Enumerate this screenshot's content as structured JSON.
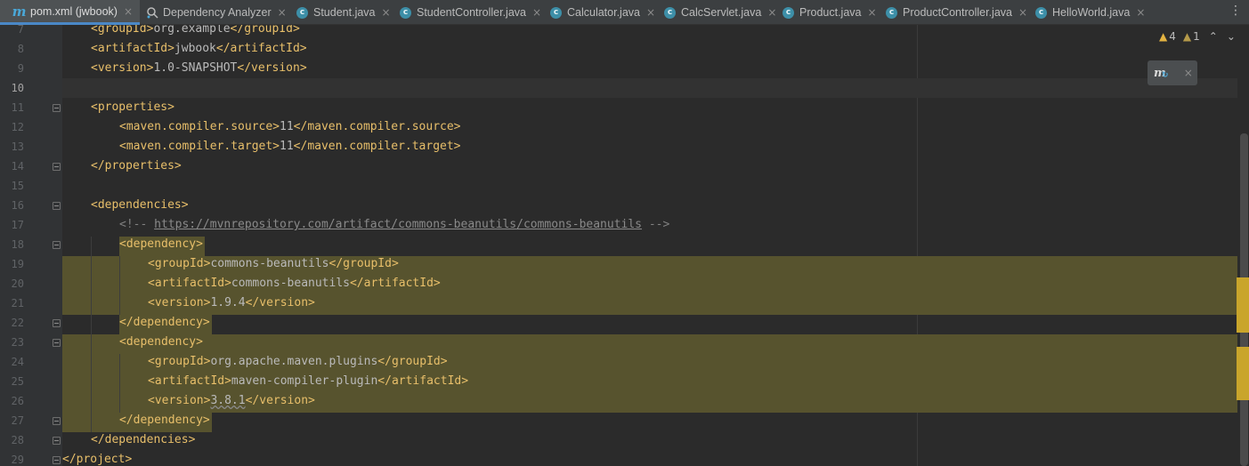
{
  "tabs": [
    {
      "label": "pom.xml (jwbook)",
      "icon": "maven-file-icon",
      "active": true
    },
    {
      "label": "Dependency Analyzer",
      "icon": "dependency-analyzer-icon"
    },
    {
      "label": "Student.java",
      "icon": "java-class-icon"
    },
    {
      "label": "StudentController.java",
      "icon": "java-class-icon"
    },
    {
      "label": "Calculator.java",
      "icon": "java-class-icon"
    },
    {
      "label": "CalcServlet.java",
      "icon": "java-class-icon"
    },
    {
      "label": "Product.java",
      "icon": "java-class-icon"
    },
    {
      "label": "ProductController.java",
      "icon": "java-class-icon"
    },
    {
      "label": "HelloWorld.java",
      "icon": "java-class-icon"
    }
  ],
  "icon_glyphs": {
    "maven": "m",
    "java_class": "c",
    "close": "×",
    "menu": "⋮"
  },
  "inspection": {
    "warnings": "4",
    "weak_warnings": "1"
  },
  "lines": [
    {
      "n": "7",
      "code": "<groupId>org.example</groupId>"
    },
    {
      "n": "8",
      "code": "<artifactId>jwbook</artifactId>"
    },
    {
      "n": "9",
      "code": "<version>1.0-SNAPSHOT</version>"
    },
    {
      "n": "10",
      "code": ""
    },
    {
      "n": "11",
      "code": "<properties>"
    },
    {
      "n": "12",
      "code": "<maven.compiler.source>11</maven.compiler.source>"
    },
    {
      "n": "13",
      "code": "<maven.compiler.target>11</maven.compiler.target>"
    },
    {
      "n": "14",
      "code": "</properties>"
    },
    {
      "n": "15",
      "code": ""
    },
    {
      "n": "16",
      "code": "<dependencies>"
    },
    {
      "n": "17",
      "code": "<!-- https://mvnrepository.com/artifact/commons-beanutils/commons-beanutils -->"
    },
    {
      "n": "18",
      "code": "<dependency>"
    },
    {
      "n": "19",
      "code": "<groupId>commons-beanutils</groupId>"
    },
    {
      "n": "20",
      "code": "<artifactId>commons-beanutils</artifactId>"
    },
    {
      "n": "21",
      "code": "<version>1.9.4</version>"
    },
    {
      "n": "22",
      "code": "</dependency>"
    },
    {
      "n": "23",
      "code": "<dependency>"
    },
    {
      "n": "24",
      "code": "<groupId>org.apache.maven.plugins</groupId>"
    },
    {
      "n": "25",
      "code": "<artifactId>maven-compiler-plugin</artifactId>"
    },
    {
      "n": "26",
      "code": "<version>3.8.1</version>"
    },
    {
      "n": "27",
      "code": "</dependency>"
    },
    {
      "n": "28",
      "code": "</dependencies>"
    },
    {
      "n": "29",
      "code": "</project>"
    }
  ],
  "colors": {
    "tag": "#e8bf6a",
    "text": "#bababa",
    "comment": "#808080",
    "highlight": "#57532e",
    "marker": "#c9a52b"
  }
}
